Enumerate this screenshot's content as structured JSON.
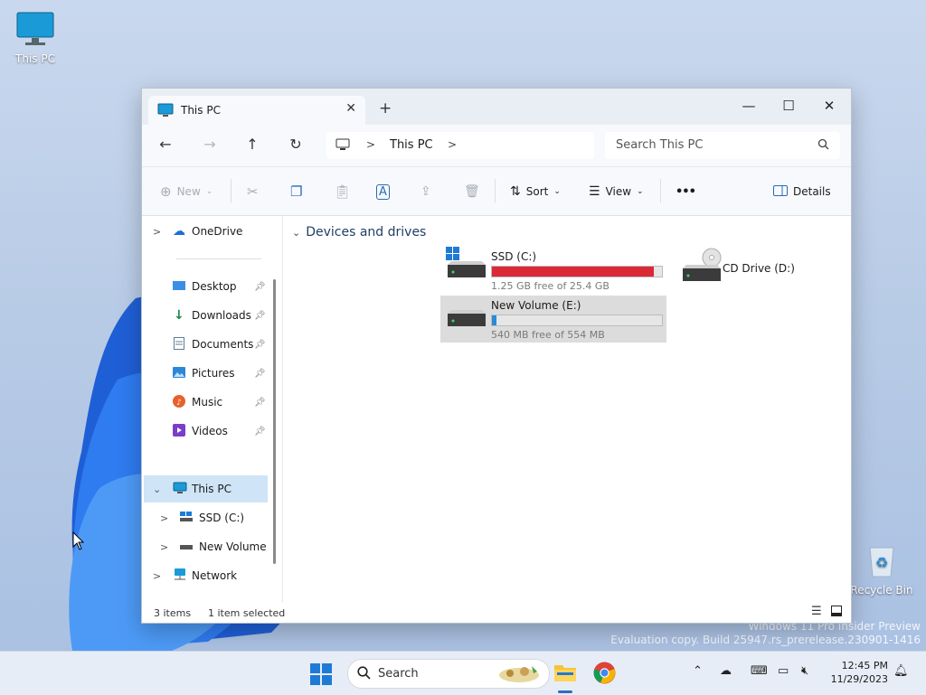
{
  "desktop": {
    "this_pc_label": "This PC",
    "recycle_bin_label": "Recycle Bin",
    "watermark_line1": "Windows 11 Pro Insider Preview",
    "watermark_line2": "Evaluation copy. Build 25947.rs_prerelease.230901-1416"
  },
  "window": {
    "tab_title": "This PC",
    "new_tab": "+",
    "controls": {
      "minimize": "—",
      "maximize": "☐",
      "close": "✕"
    }
  },
  "address": {
    "location": "This PC",
    "search_placeholder": "Search This PC"
  },
  "toolbar": {
    "new_label": "New",
    "sort_label": "Sort",
    "view_label": "View",
    "more_label": "•••",
    "details_label": "Details"
  },
  "sidebar": {
    "onedrive": "OneDrive",
    "quick": [
      "Desktop",
      "Downloads",
      "Documents",
      "Pictures",
      "Music",
      "Videos"
    ],
    "this_pc": "This PC",
    "ssd": "SSD (C:)",
    "new_volume": "New Volume (E:)",
    "network": "Network"
  },
  "content": {
    "group_header": "Devices and drives",
    "drives": [
      {
        "name": "SSD (C:)",
        "free_text": "1.25 GB free of 25.4 GB",
        "used_fraction": 0.95,
        "bar_color": "#da2a36"
      },
      {
        "name": "CD Drive (D:)"
      },
      {
        "name": "New Volume (E:)",
        "free_text": "540 MB free of 554 MB",
        "used_fraction": 0.025,
        "bar_color": "#2a8bd6"
      }
    ]
  },
  "status": {
    "items": "3 items",
    "selected": "1 item selected"
  },
  "taskbar": {
    "search_label": "Search",
    "time": "12:45 PM",
    "date": "11/29/2023"
  },
  "colors": {
    "accent": "#0067c0",
    "selection": "#cfe4f7"
  }
}
